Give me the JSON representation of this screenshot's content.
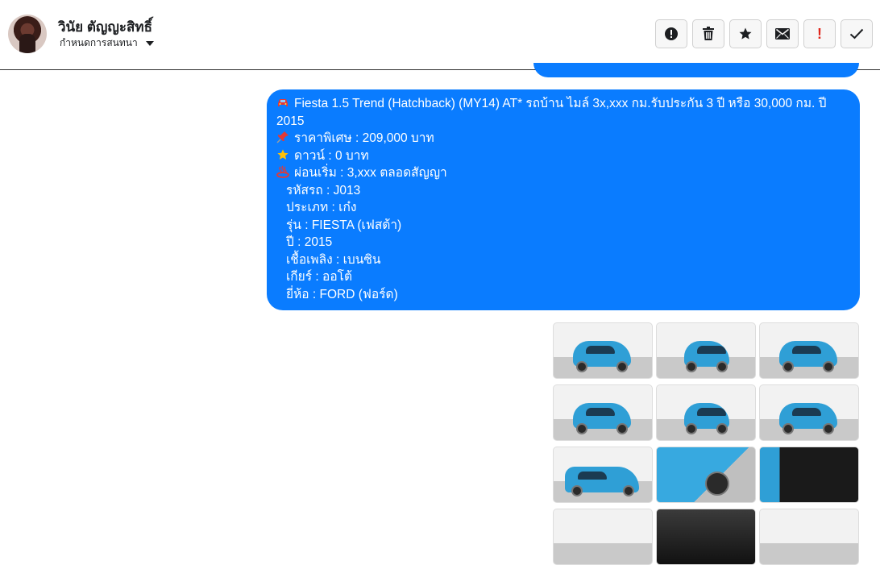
{
  "header": {
    "name": "วินัย ตัญญะสิทธิ์",
    "subtitle": "กำหนดการสนทนา",
    "actions": [
      {
        "name": "report-icon",
        "label": "แจ้งปัญหา"
      },
      {
        "name": "trash-icon",
        "label": "ลบ"
      },
      {
        "name": "star-icon",
        "label": "ติดดาว"
      },
      {
        "name": "mail-icon",
        "label": "ยังไม่อ่าน"
      },
      {
        "name": "important-icon",
        "label": "สำคัญ"
      },
      {
        "name": "check-icon",
        "label": "เสร็จสิ้น"
      }
    ]
  },
  "message": {
    "title": "Fiesta 1.5 Trend (Hatchback) (MY14) AT* รถบ้าน ไมล์ 3x,xxx กม.รับประกัน 3 ปี หรือ 30,000 กม. ปี 2015",
    "price": "ราคาพิเศษ : 209,000 บาท",
    "down": "ดาวน์ : 0 บาท",
    "installment": "ผ่อนเริ่ม : 3,xxx ตลอดสัญญา",
    "details": [
      "รหัสรถ : J013",
      "ประเภท : เก๋ง",
      "รุ่น : FIESTA (เฟสต้า)",
      "ปี : 2015",
      "เชื้อเพลิง : เบนซิน",
      "เกียร์ : ออโต้",
      "ยี่ห้อ : FORD (ฟอร์ด)"
    ],
    "icons": [
      "car-icon",
      "pin-icon",
      "star-icon",
      "hotspring-icon"
    ]
  },
  "colors": {
    "bubble": "#0a7cff",
    "important": "#e0261b"
  },
  "gallery": {
    "photo_count": 12,
    "photos": [
      "front-left",
      "front",
      "front-right",
      "rear-left",
      "rear",
      "rear-right",
      "side",
      "front-close",
      "door-interior",
      "partial",
      "partial",
      "partial"
    ]
  }
}
